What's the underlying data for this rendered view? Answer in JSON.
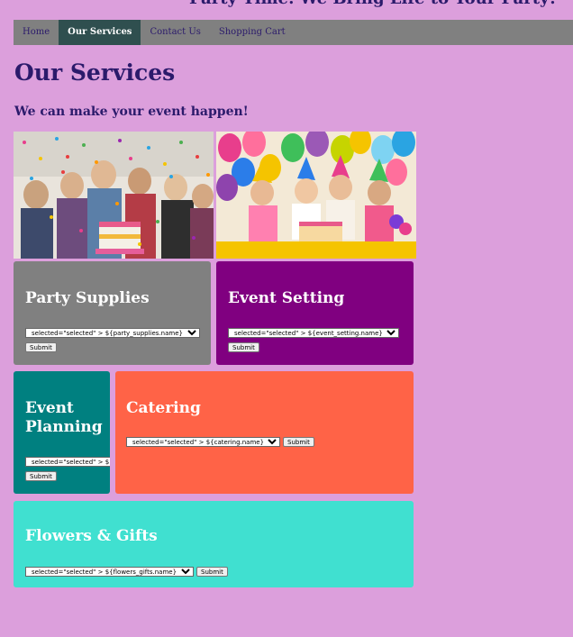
{
  "header": {
    "tagline": "Party Time: We Bring Life to Your Party!"
  },
  "nav": {
    "items": [
      {
        "label": "Home"
      },
      {
        "label": "Our Services"
      },
      {
        "label": "Contact Us"
      },
      {
        "label": "Shopping Cart"
      }
    ],
    "active": "Our Services"
  },
  "page": {
    "title": "Our Services",
    "subtitle": "We can make your event happen!"
  },
  "services": {
    "party_supplies": {
      "title": "Party Supplies",
      "select_value": "selected=\"selected\" > ${party_supplies.name}",
      "submit_label": "Submit",
      "color": "#808080"
    },
    "event_setting": {
      "title": "Event Setting",
      "select_value": "selected=\"selected\" > ${event_setting.name}",
      "submit_label": "Submit",
      "color": "#800080"
    },
    "event_planning": {
      "title": "Event Planning",
      "select_value": "selected=\"selected\" > ${event_planning.name}",
      "submit_label": "Submit",
      "color": "#008080"
    },
    "catering": {
      "title": "Catering",
      "select_value": "selected=\"selected\" > ${catering.name}",
      "submit_label": "Submit",
      "color": "#ff6347"
    },
    "flowers_gifts": {
      "title": "Flowers & Gifts",
      "select_value": "selected=\"selected\" > ${flowers_gifts.name}",
      "submit_label": "Submit",
      "color": "#40e0d0"
    }
  },
  "theme": {
    "background": "#dc9fdc",
    "nav_bg": "#808080",
    "nav_active": "#2f4f4f",
    "text": "#2b1a6b"
  }
}
